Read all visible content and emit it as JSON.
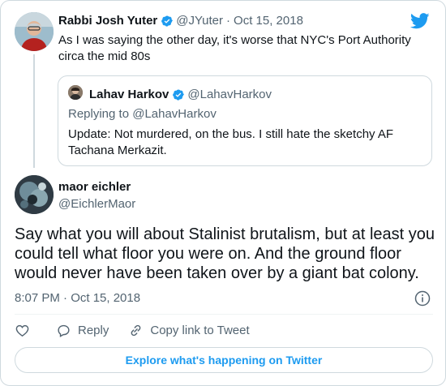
{
  "colors": {
    "accent": "#1d9bf0",
    "muted": "#536471",
    "border": "#cfd9de",
    "text": "#0f1419"
  },
  "brand": {
    "icon": "twitter-bird-icon"
  },
  "parent_tweet": {
    "name": "Rabbi Josh Yuter",
    "handle": "@JYuter",
    "separator": "·",
    "date": "Oct 15, 2018",
    "text": "As I was saying the other day, it's worse that NYC's Port Authority circa the mid 80s",
    "verified_icon": "verified-badge-icon"
  },
  "quoted_tweet": {
    "name": "Lahav Harkov",
    "handle": "@LahavHarkov",
    "replying_to": "Replying to @LahavHarkov",
    "text": "Update: Not murdered, on the bus. I still hate the sketchy AF Tachana Merkazit.",
    "verified_icon": "verified-badge-icon"
  },
  "main_tweet": {
    "name": "maor eichler",
    "handle": "@EichlerMaor",
    "text": "Say what you will about Stalinist brutalism, but at least you could tell what floor you were on. And the ground floor would never have been taken over by a giant bat colony.",
    "timestamp": "8:07 PM · Oct 15, 2018"
  },
  "actions": {
    "like_icon": "heart-icon",
    "reply_icon": "speech-bubble-icon",
    "reply_label": "Reply",
    "copy_icon": "link-icon",
    "copy_label": "Copy link to Tweet",
    "info_icon": "info-icon"
  },
  "explore": {
    "label": "Explore what's happening on Twitter"
  }
}
